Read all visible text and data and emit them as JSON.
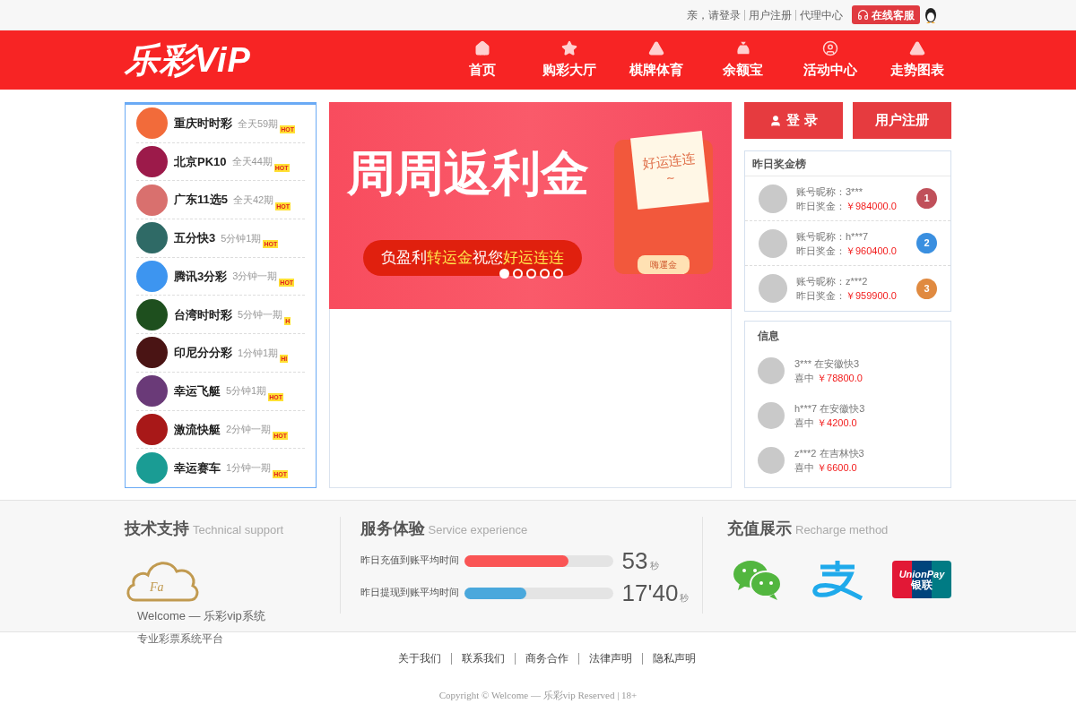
{
  "topbar": {
    "greeting": "亲，请登录",
    "links": [
      "用户注册",
      "代理中心"
    ],
    "service_button": "在线客服"
  },
  "header": {
    "logo": "乐彩ViP",
    "nav": [
      {
        "label": "首页",
        "kind": "home"
      },
      {
        "label": "购彩大厅",
        "kind": "star"
      },
      {
        "label": "棋牌体育",
        "kind": "triangle"
      },
      {
        "label": "余额宝",
        "kind": "bag"
      },
      {
        "label": "活动中心",
        "kind": "user"
      },
      {
        "label": "走势图表",
        "kind": "triangle"
      }
    ]
  },
  "lotteries": [
    {
      "name": "重庆时时彩",
      "schedule": "全天59期",
      "badge": "HOT",
      "color": "#f26b3a"
    },
    {
      "name": "北京PK10",
      "schedule": "全天44期",
      "badge": "HOT",
      "color": "#9c1a4a"
    },
    {
      "name": "广东11选5",
      "schedule": "全天42期",
      "badge": "HOT",
      "color": "#d9706e"
    },
    {
      "name": "五分快3",
      "schedule": "5分钟1期",
      "badge": "HOT",
      "color": "#2f6a66"
    },
    {
      "name": "腾讯3分彩",
      "schedule": "3分钟一期",
      "badge": "HOT",
      "color": "#3d95f0"
    },
    {
      "name": "台湾时时彩",
      "schedule": "5分钟一期",
      "badge": "H",
      "color": "#1e4f1e"
    },
    {
      "name": "印尼分分彩",
      "schedule": "1分钟1期",
      "badge": "HI",
      "color": "#4a1414"
    },
    {
      "name": "幸运飞艇",
      "schedule": "5分钟1期",
      "badge": "HOT",
      "color": "#6a3a78"
    },
    {
      "name": "激流快艇",
      "schedule": "2分钟一期",
      "badge": "HOT",
      "color": "#a81818"
    },
    {
      "name": "幸运赛车",
      "schedule": "1分钟一期",
      "badge": "HOT",
      "color": "#1a9c94"
    }
  ],
  "banner": {
    "title": "周周返利金",
    "slogan_a": "负盈利",
    "slogan_b": "转运金",
    "slogan_c": " 祝您",
    "slogan_d": "好运连连",
    "note": "好运连连~",
    "coupon": "嗨運金",
    "dots": [
      {
        "selected": true
      },
      {
        "selected": false
      },
      {
        "selected": false
      },
      {
        "selected": false
      },
      {
        "selected": false
      }
    ]
  },
  "auth": {
    "login": "登 录",
    "register": "用户注册"
  },
  "leaderboard": {
    "title": "昨日奖金榜",
    "rows": [
      {
        "nickname": "账号昵称：3***",
        "prize_label": "昨日奖金：",
        "prize": "￥984000.0",
        "rank": "1",
        "color": "#c0505a"
      },
      {
        "nickname": "账号昵称：h***7",
        "prize_label": "昨日奖金：",
        "prize": "￥960400.0",
        "rank": "2",
        "color": "#3a8fe0"
      },
      {
        "nickname": "账号昵称：z***2",
        "prize_label": "昨日奖金：",
        "prize": "￥959900.0",
        "rank": "3",
        "color": "#e08a40"
      }
    ]
  },
  "wins": {
    "title": "信息",
    "rows": [
      {
        "text": "3*** 在安徽快3",
        "label": "喜中",
        "amount": "￥78800.0"
      },
      {
        "text": "h***7 在安徽快3",
        "label": "喜中",
        "amount": "￥4200.0"
      },
      {
        "text": "z***2 在吉林快3",
        "label": "喜中",
        "amount": "￥6600.0"
      }
    ]
  },
  "support": {
    "title": "技术支持",
    "subtitle": "Technical support",
    "cloud_text": "Fa",
    "lines": [
      "Welcome — 乐彩vip系统",
      "专业彩票系统平台"
    ]
  },
  "service": {
    "title": "服务体验",
    "subtitle": "Service experience",
    "metrics": [
      {
        "label": "昨日充值到账平均时间",
        "level": 0.7,
        "value": "53",
        "unit": "秒",
        "color": "#fa5555"
      },
      {
        "label": "昨日提现到账平均时间",
        "level": 0.42,
        "value": "17'40",
        "unit": "秒",
        "color": "#4aa8dc"
      }
    ]
  },
  "recharge": {
    "title": "充值展示",
    "subtitle": "Recharge method",
    "methods": [
      {
        "kind": "wechat"
      },
      {
        "kind": "alipay"
      },
      {
        "kind": "unionpay",
        "text_a": "UnionPay",
        "text_b": "银联"
      }
    ]
  },
  "footer": {
    "links": [
      "关于我们",
      "联系我们",
      "商务合作",
      "法律声明",
      "隐私声明"
    ],
    "copyright": "Copyright © Welcome — 乐彩vip Reserved | 18+"
  }
}
